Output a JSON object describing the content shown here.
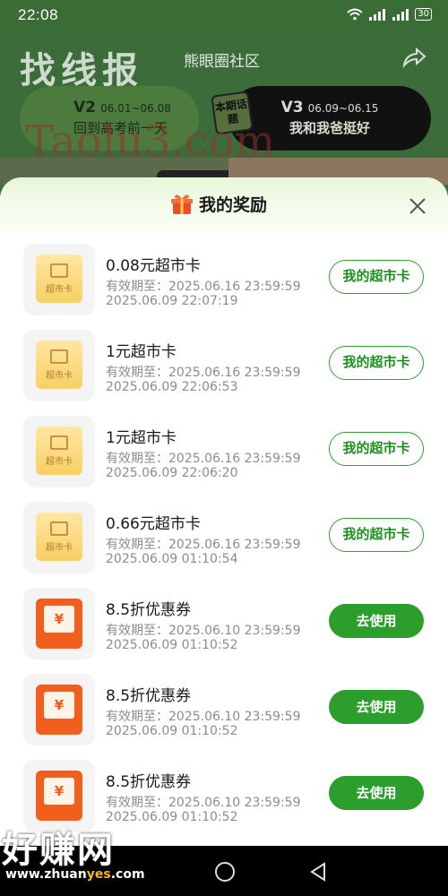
{
  "status_bar": {
    "time": "22:08",
    "battery": "30",
    "signal": "4G"
  },
  "background": {
    "watermark_title": "找线报",
    "community": "熊眼圈社区",
    "watermark_url": "Taolu3.com",
    "periods": [
      {
        "version": "V2",
        "dates": "06.01~06.08",
        "topic": "回到高考前一天"
      },
      {
        "version": "V3",
        "dates": "06.09~06.15",
        "topic": "我和我爸挺好"
      }
    ],
    "badge": "本期话题"
  },
  "sheet": {
    "title": "我的奖励",
    "expiry_prefix": "有效期至：",
    "items": [
      {
        "type": "card",
        "icon_label": "超市卡",
        "title": "0.08元超市卡",
        "expiry": "2025.06.16 23:59:59",
        "time": "2025.06.09 22:07:19",
        "action": "我的超市卡"
      },
      {
        "type": "card",
        "icon_label": "超市卡",
        "title": "1元超市卡",
        "expiry": "2025.06.16 23:59:59",
        "time": "2025.06.09 22:06:53",
        "action": "我的超市卡"
      },
      {
        "type": "card",
        "icon_label": "超市卡",
        "title": "1元超市卡",
        "expiry": "2025.06.16 23:59:59",
        "time": "2025.06.09 22:06:20",
        "action": "我的超市卡"
      },
      {
        "type": "card",
        "icon_label": "超市卡",
        "title": "0.66元超市卡",
        "expiry": "2025.06.16 23:59:59",
        "time": "2025.06.09 01:10:54",
        "action": "我的超市卡"
      },
      {
        "type": "coupon",
        "icon_label": "¥",
        "title": "8.5折优惠券",
        "expiry": "2025.06.10 23:59:59",
        "time": "2025.06.09 01:10:52",
        "action": "去使用"
      },
      {
        "type": "coupon",
        "icon_label": "¥",
        "title": "8.5折优惠券",
        "expiry": "2025.06.10 23:59:59",
        "time": "2025.06.09 01:10:52",
        "action": "去使用"
      },
      {
        "type": "coupon",
        "icon_label": "¥",
        "title": "8.5折优惠券",
        "expiry": "2025.06.10 23:59:59",
        "time": "2025.06.09 01:10:52",
        "action": "去使用"
      }
    ]
  },
  "watermark_bottom": {
    "text": "好赚网",
    "url_pre": "www.zhuan",
    "url_mid": "yes",
    "url_post": ".com"
  },
  "colors": {
    "primary_green": "#2b9e2b",
    "coupon_orange": "#f25f1c",
    "card_gold": "#f7cf64"
  }
}
